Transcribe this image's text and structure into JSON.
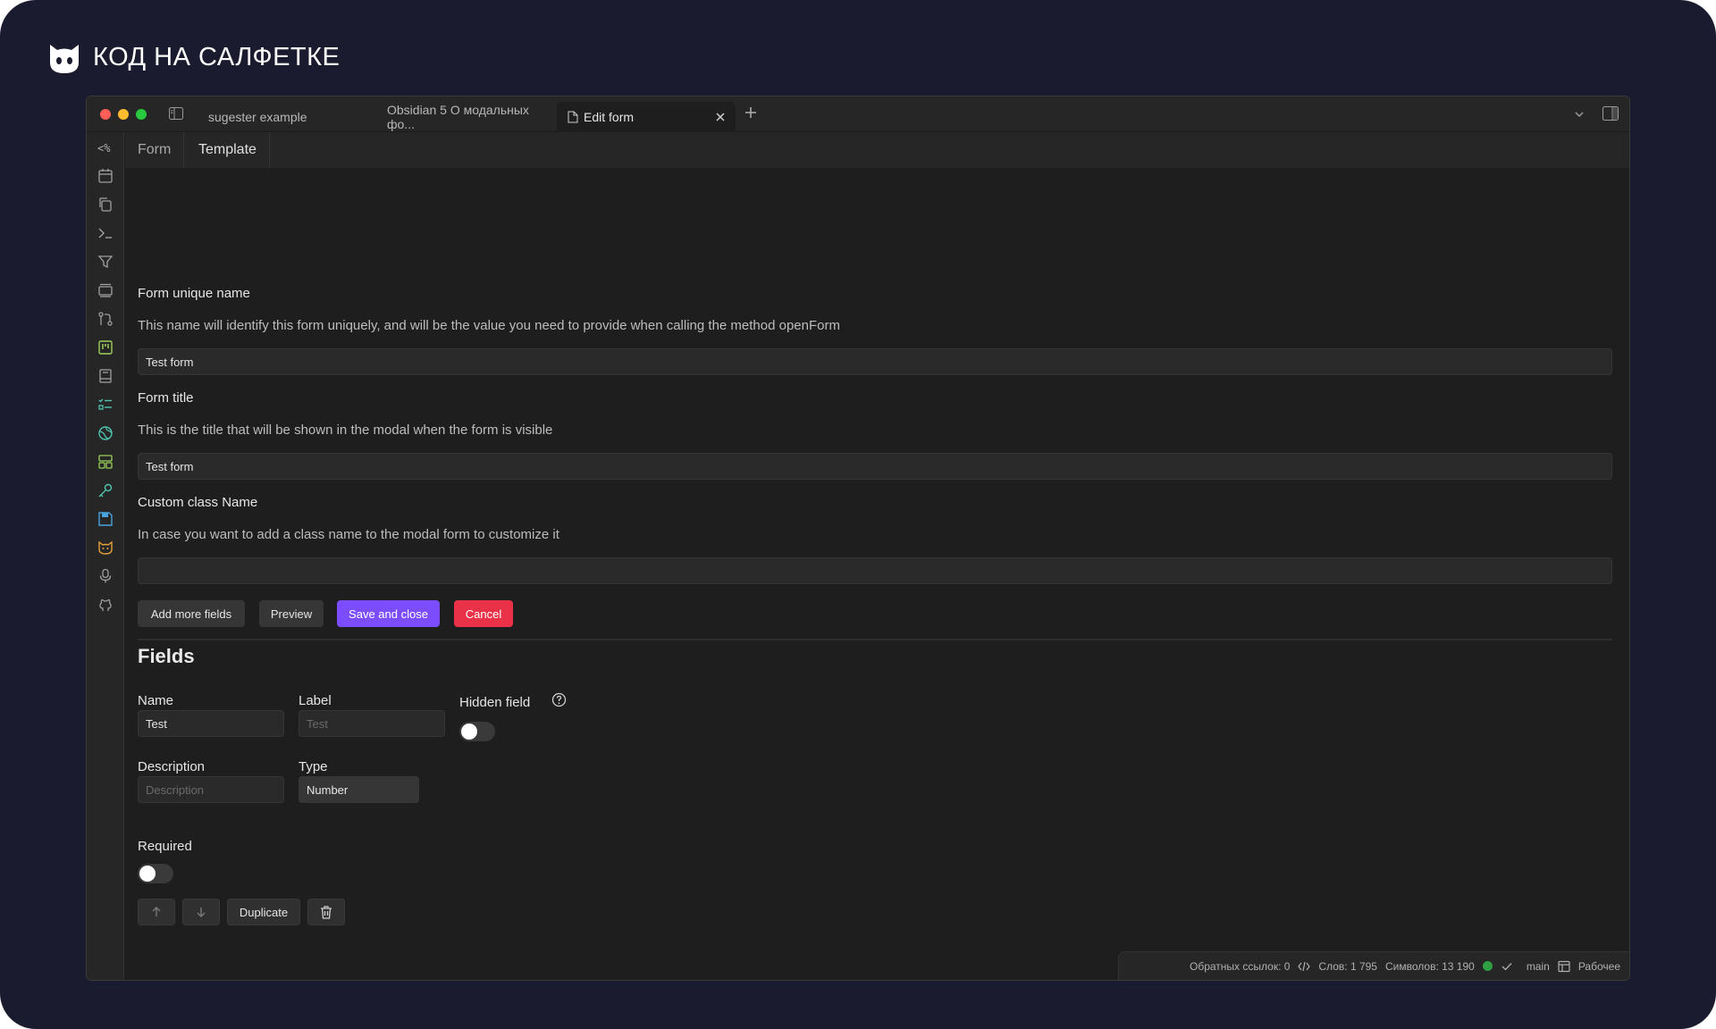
{
  "brand": {
    "title": "КОД НА САЛФЕТКЕ",
    "logo_icon": "cat-head-icon"
  },
  "tabs": [
    {
      "label": "sugester example",
      "active": false
    },
    {
      "label": "Obsidian 5 О модальных фо...",
      "active": false
    },
    {
      "label": "Edit form",
      "active": true
    }
  ],
  "view_tabs": {
    "form": "Form",
    "template": "Template"
  },
  "ribbon_icons": [
    "templater-icon",
    "calendar-icon",
    "copy-icon",
    "terminal-icon",
    "filter-icon",
    "layers-icon",
    "git-icon",
    "kanban-icon",
    "book-icon",
    "tasks-icon",
    "globe-icon",
    "dashboard-icon",
    "key-icon",
    "save-icon",
    "cat-icon",
    "mic-icon",
    "github-icon"
  ],
  "form": {
    "unique_name_label": "Form unique name",
    "unique_name_desc": "This name will identify this form uniquely, and will be the value you need to provide when calling the method openForm",
    "unique_name_value": "Test form",
    "title_label": "Form title",
    "title_desc": "This is the title that will be shown in the modal when the form is visible",
    "title_value": "Test form",
    "class_label": "Custom class Name",
    "class_desc": "In case you want to add a class name to the modal form to customize it",
    "class_value": ""
  },
  "buttons": {
    "add_more": "Add more fields",
    "preview": "Preview",
    "save_close": "Save and close",
    "cancel": "Cancel"
  },
  "fields": {
    "heading": "Fields",
    "name_label": "Name",
    "name_value": "Test",
    "label_label": "Label",
    "label_placeholder": "Test",
    "hidden_label": "Hidden field",
    "hidden_on": false,
    "description_label": "Description",
    "description_placeholder": "Description",
    "type_label": "Type",
    "type_value": "Number",
    "required_label": "Required",
    "required_on": false,
    "duplicate": "Duplicate"
  },
  "statusbar": {
    "backlinks": "Обратных ссылок: 0",
    "words": "Слов: 1 795",
    "chars": "Символов: 13 190",
    "branch": "main",
    "workspace": "Рабочее"
  },
  "colors": {
    "accent": "#7c4dff",
    "danger": "#e93147",
    "background": "#1e1e1e",
    "frame": "#1a1b2e"
  }
}
